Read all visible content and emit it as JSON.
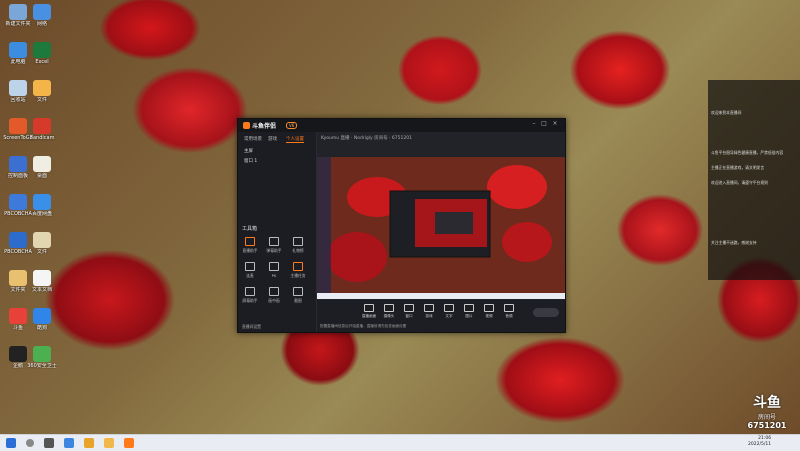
{
  "desktop_icons": [
    {
      "label": "新建文件夹",
      "color": "#7aa7d8"
    },
    {
      "label": "网络",
      "color": "#4a90e2"
    },
    {
      "label": "此电脑",
      "color": "#3c8de0"
    },
    {
      "label": "Excel",
      "color": "#1e7a3c"
    },
    {
      "label": "回收站",
      "color": "#bcd3ea"
    },
    {
      "label": "文件",
      "color": "#f3b44a"
    },
    {
      "label": "ScreenToGif",
      "color": "#e25a2a"
    },
    {
      "label": "Bandicam",
      "color": "#d63a2a"
    },
    {
      "label": "控制面板",
      "color": "#3b6fd1"
    },
    {
      "label": "桌面",
      "color": "#f0ede3"
    },
    {
      "label": "PBCOBCHA",
      "color": "#3d7ad9"
    },
    {
      "label": "百度网盘",
      "color": "#3a8fe8"
    },
    {
      "label": "PBCOBCHA",
      "color": "#2d6bcc"
    },
    {
      "label": "文件",
      "color": "#e2d6b0"
    },
    {
      "label": "文件夹",
      "color": "#e8c070"
    },
    {
      "label": "文本文档",
      "color": "#f5f5f5"
    },
    {
      "label": "斗鱼",
      "color": "#e8413a"
    },
    {
      "label": "酷狗",
      "color": "#2f86e8"
    },
    {
      "label": "企鹅",
      "color": "#222222"
    },
    {
      "label": "360安全卫士",
      "color": "#4caf50"
    }
  ],
  "app": {
    "name": "斗鱼伴侣",
    "version": "V6",
    "tabs": [
      "常用场景",
      "游戏",
      "个人设置"
    ],
    "scenes": [
      "主屏",
      "窗口 1"
    ],
    "tools_title": "工具箱",
    "tools": [
      "直播助手",
      "弹幕助手",
      "礼物榜",
      "连麦",
      "PK",
      "主播任务",
      "屏幕助手",
      "画中画",
      "截图"
    ],
    "footer": "直播间设置",
    "room_line": "Kyoumu 直播 · Nodrigly 房间号 · 6751201",
    "bottom_buttons": [
      "直播画面",
      "摄像头",
      "窗口",
      "游戏",
      "文字",
      "图片",
      "视频",
      "音频"
    ],
    "status": "配置直播间信息后开始直播，直播前请先检查画面设置"
  },
  "chat_panel": [
    "欢迎来到本直播间",
    "斗鱼平台倡导绿色健康直播，严禁低俗内容",
    "主播正在直播游戏，请文明发言",
    "欢迎进入直播间，请遵守平台规则",
    "关注主播不迷路，感谢支持"
  ],
  "taskbar": {
    "time": "21:06",
    "date": "2022/5/11"
  },
  "watermark": {
    "brand": "斗鱼",
    "room_label": "房间号",
    "room_id": "6751201"
  }
}
